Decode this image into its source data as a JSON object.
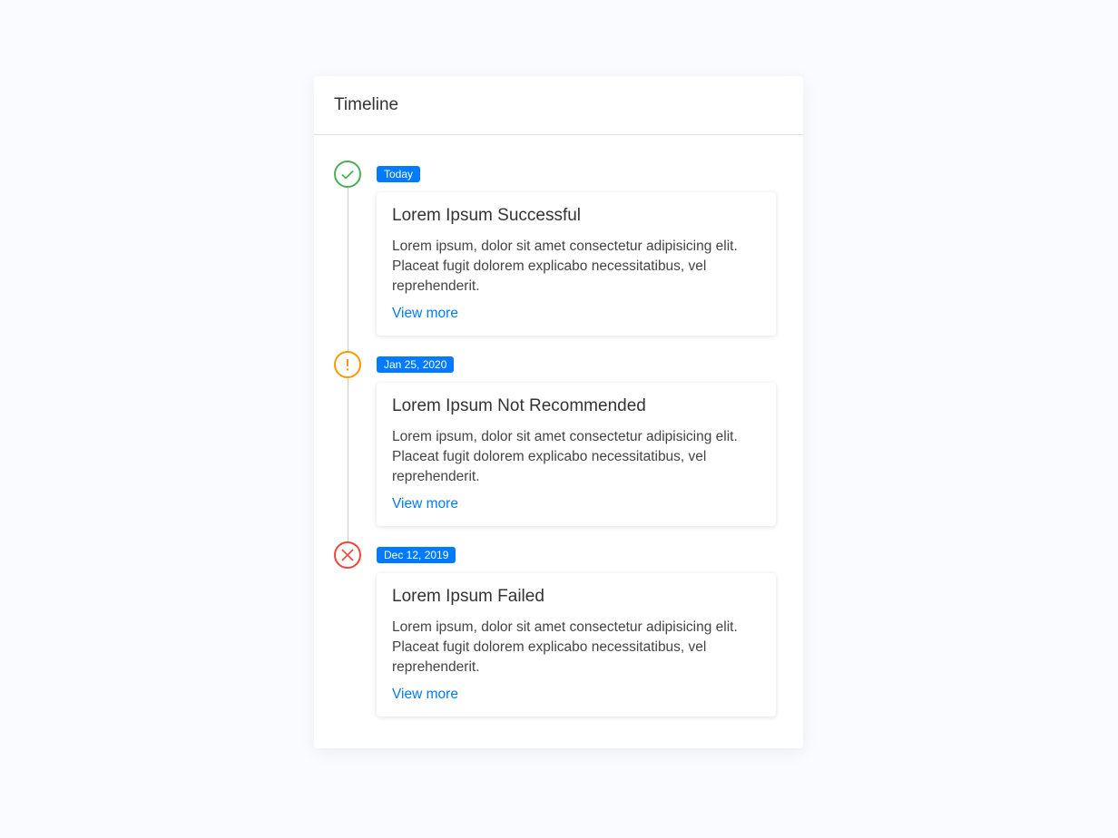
{
  "title": "Timeline",
  "colors": {
    "success": "#4caf50",
    "warning": "#ff9800",
    "danger": "#f44336",
    "accent": "#007bff"
  },
  "items": [
    {
      "date": "Today",
      "status_icon": "check-icon",
      "title": "Lorem Ipsum Successful",
      "text": "Lorem ipsum, dolor sit amet consectetur adipisicing elit. Placeat fugit dolorem explicabo necessitatibus, vel reprehenderit.",
      "link": "View more"
    },
    {
      "date": "Jan 25, 2020",
      "status_icon": "exclamation-icon",
      "title": "Lorem Ipsum Not Recommended",
      "text": "Lorem ipsum, dolor sit amet consectetur adipisicing elit. Placeat fugit dolorem explicabo necessitatibus, vel reprehenderit.",
      "link": "View more"
    },
    {
      "date": "Dec 12, 2019",
      "status_icon": "x-icon",
      "title": "Lorem Ipsum Failed",
      "text": "Lorem ipsum, dolor sit amet consectetur adipisicing elit. Placeat fugit dolorem explicabo necessitatibus, vel reprehenderit.",
      "link": "View more"
    }
  ]
}
